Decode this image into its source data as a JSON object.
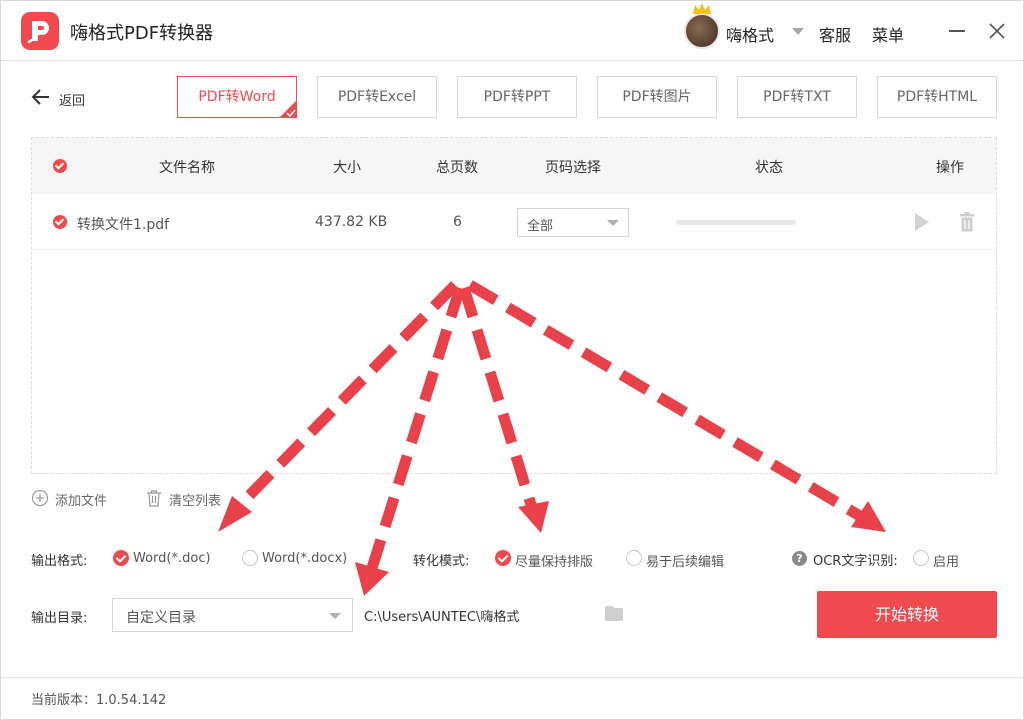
{
  "app": {
    "title": "嗨格式PDF转换器",
    "user_name": "嗨格式",
    "support_label": "客服",
    "menu_label": "菜单"
  },
  "nav": {
    "back_label": "返回",
    "tabs": [
      "PDF转Word",
      "PDF转Excel",
      "PDF转PPT",
      "PDF转图片",
      "PDF转TXT",
      "PDF转HTML"
    ],
    "active_tab": "PDF转Word"
  },
  "table": {
    "headers": {
      "name": "文件名称",
      "size": "大小",
      "pages": "总页数",
      "page_select": "页码选择",
      "status": "状态",
      "actions": "操作"
    },
    "rows": [
      {
        "name": "转换文件1.pdf",
        "size": "437.82 KB",
        "pages": "6",
        "page_select": "全部",
        "progress": 0
      }
    ]
  },
  "list_actions": {
    "add_file": "添加文件",
    "clear_list": "清空列表"
  },
  "options": {
    "output_format_label": "输出格式:",
    "format_doc": "Word(*.doc)",
    "format_docx": "Word(*.docx)",
    "selected_format": "Word(*.doc)",
    "mode_label": "转化模式:",
    "mode_keep_layout": "尽量保持排版",
    "mode_easy_edit": "易于后续编辑",
    "selected_mode": "尽量保持排版",
    "ocr_label": "OCR文字识别:",
    "ocr_enable": "启用",
    "ocr_enabled": false
  },
  "output": {
    "dir_label": "输出目录:",
    "dir_mode": "自定义目录",
    "dir_path": "C:\\Users\\AUNTEC\\嗨格式"
  },
  "start_label": "开始转换",
  "footer": {
    "version": "当前版本：1.0.54.142"
  },
  "colors": {
    "accent": "#f04a4f",
    "arrow": "#e8414a"
  }
}
